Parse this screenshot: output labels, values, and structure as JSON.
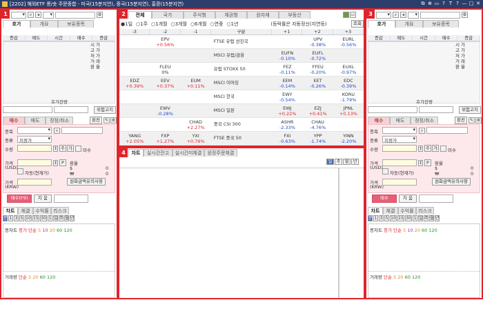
{
  "title": "[2202] 해외ETF 롱/숏 주문종합 - 미국(15분지연), 중국(15분지연), 홍콩(15분지연)",
  "window_controls": [
    "⧉",
    "⊕",
    "▭",
    "?",
    "T",
    "?",
    "—",
    "□",
    "✕"
  ],
  "badges": [
    "1",
    "2",
    "3",
    "4"
  ],
  "left": {
    "tabs": [
      "호가",
      "개요",
      "보유종목"
    ],
    "grid_headers": [
      "증감",
      "매도",
      "시간",
      "매수",
      "증감"
    ],
    "side_labels": [
      "시",
      "고",
      "저",
      "거",
      "환"
    ],
    "side_labels2": [
      "가",
      "가",
      "가",
      "래",
      "율"
    ],
    "hoga_remain": "호가잔량",
    "risk_btn": "위험고지",
    "order_tabs": [
      "매수",
      "매도",
      "정정/취소"
    ],
    "env_btn": "환전",
    "stock_lbl": "종목",
    "type_lbl": "종류",
    "type_val": "지정가",
    "qty_lbl": "수량",
    "qty_btns": [
      "주",
      "가"
    ],
    "unmarked": "미수",
    "price_usd_lbl": "가격",
    "price_usd_unit": "(USD)",
    "p_btn": "P",
    "exch_lbl": "환율",
    "usd_sym": "$",
    "krw_sym": "₩",
    "usd_val": "0",
    "krw_val": "0",
    "auto_rate": "자동(현재가)",
    "price_krw_lbl": "가격",
    "price_krw_unit": "(KRW)",
    "fx_note_btn": "원화금액유의사항",
    "submit_btn": "매수(F9)",
    "reset_btn": "지 움",
    "chart_tabs": [
      "차트",
      "체결",
      "수익률",
      "리스크"
    ],
    "periods": [
      "분",
      "1",
      "3",
      "5",
      "10",
      "15",
      "30",
      "1",
      "일",
      "주",
      "월",
      "년"
    ],
    "ma_label": "봉차트",
    "ma_tag": "종가 단순",
    "ma_vals": [
      "5",
      "10",
      "20",
      "60",
      "120"
    ],
    "vol_label": "거래량",
    "vol_tag": "단순",
    "vol_vals": [
      "5",
      "20",
      "60",
      "120"
    ]
  },
  "right": {
    "tabs": [
      "호가",
      "개요",
      "보유종목"
    ],
    "grid_headers": [
      "증감",
      "매도",
      "시간",
      "매수",
      "증감"
    ],
    "side_labels": [
      "시",
      "고",
      "저",
      "거",
      "환"
    ],
    "side_labels2": [
      "가",
      "가",
      "가",
      "래",
      "율"
    ],
    "hoga_remain": "호가잔량",
    "risk_btn": "위험고지",
    "order_tabs": [
      "매수",
      "매도",
      "정정/취소"
    ],
    "env_btn": "환전",
    "stock_lbl": "종목",
    "type_lbl": "종류",
    "type_val": "지정가",
    "qty_lbl": "수량",
    "qty_btns": [
      "주",
      "가"
    ],
    "unmarked": "미수",
    "price_usd_lbl": "가격",
    "price_usd_unit": "(USD)",
    "p_btn": "P",
    "exch_lbl": "환율",
    "usd_sym": "$",
    "krw_sym": "₩",
    "usd_val": "0",
    "krw_val": "0",
    "auto_rate": "자동(현재가)",
    "price_krw_lbl": "가격",
    "price_krw_unit": "(KRW)",
    "fx_note_btn": "원화금액유의사항",
    "submit_btn": "매수",
    "reset_btn": "지 움",
    "chart_tabs": [
      "차트",
      "체결",
      "수익률",
      "리스크"
    ],
    "periods": [
      "분",
      "1",
      "3",
      "5",
      "10",
      "15",
      "30",
      "1",
      "일",
      "주",
      "월",
      "년"
    ],
    "ma_label": "봉차트",
    "ma_tag": "종가 단순",
    "ma_vals": [
      "5",
      "10",
      "20",
      "60",
      "120"
    ],
    "vol_label": "거래량",
    "vol_tag": "단순",
    "vol_vals": [
      "5",
      "20",
      "60",
      "120"
    ]
  },
  "center": {
    "tabs": [
      "전체",
      "국가",
      "주식형",
      "채권형",
      "원자재",
      "부동산"
    ],
    "radios": [
      "1일",
      "1주",
      "1개월",
      "3개월",
      "6개월",
      "연중",
      "1년"
    ],
    "radio_selected": 0,
    "note": "(등락률은 자동정신(지연등)",
    "lookup_btn": "조회",
    "columns": [
      "-3",
      "-2",
      "-1",
      "구분",
      "+1",
      "+2",
      "+3"
    ],
    "rows": [
      {
        "name": "FTSE 유럽 선진국",
        "m3": [
          "",
          ""
        ],
        "m2": [
          "EPV",
          "+0.56%"
        ],
        "m1": [
          "",
          ""
        ],
        "p1": [
          "",
          ""
        ],
        "p2": [
          "UPV",
          "-0.38%"
        ],
        "p3": [
          "EURL",
          "-0.56%"
        ]
      },
      {
        "name": "MSCI 유럽/금융",
        "m3": [
          "",
          ""
        ],
        "m2": [
          "",
          ""
        ],
        "m1": [
          "",
          ""
        ],
        "p1": [
          "EUFN",
          "-0.10%"
        ],
        "p2": [
          "EUFL",
          "-0.72%"
        ],
        "p3": [
          "",
          ""
        ]
      },
      {
        "name": "유럽 STOXX 50",
        "m3": [
          "",
          ""
        ],
        "m2": [
          "FLEU",
          "0%"
        ],
        "m1": [
          "",
          ""
        ],
        "p1": [
          "FEZ",
          "-0.11%"
        ],
        "p2": [
          "FFEU",
          "-0.20%"
        ],
        "p3": [
          "EUXL",
          "-0.97%"
        ]
      },
      {
        "name": "MSCI 이머징",
        "m3": [
          "EDZ",
          "+0.39%"
        ],
        "m2": [
          "EEV",
          "+0.37%"
        ],
        "m1": [
          "EUM",
          "+0.11%"
        ],
        "p1": [
          "EEM",
          "-0.14%"
        ],
        "p2": [
          "EET",
          "-0.26%"
        ],
        "p3": [
          "EDC",
          "-0.39%"
        ]
      },
      {
        "name": "MSCI 한국",
        "m3": [
          "",
          ""
        ],
        "m2": [
          "",
          ""
        ],
        "m1": [
          "",
          ""
        ],
        "p1": [
          "EWY",
          "-0.54%"
        ],
        "p2": [
          "",
          ""
        ],
        "p3": [
          "KORU",
          "-1.79%"
        ]
      },
      {
        "name": "MSCI 일본",
        "m3": [
          "",
          ""
        ],
        "m2": [
          "EWV",
          "-0.28%"
        ],
        "m1": [
          "",
          ""
        ],
        "p1": [
          "EWJ",
          "+0.22%"
        ],
        "p2": [
          "EZJ",
          "+0.41%"
        ],
        "p3": [
          "JPNL",
          "+0.13%"
        ]
      },
      {
        "name": "중국 CSI 300",
        "m3": [
          "",
          ""
        ],
        "m2": [
          "",
          ""
        ],
        "m1": [
          "CHAD",
          "+2.27%"
        ],
        "p1": [
          "ASHR",
          "-2.33%"
        ],
        "p2": [
          "CHAU",
          "-4.76%"
        ],
        "p3": [
          "",
          ""
        ]
      },
      {
        "name": "FTSE 중국 50",
        "m3": [
          "YANG",
          "+2.05%"
        ],
        "m2": [
          "FXP",
          "+1.27%"
        ],
        "m1": [
          "YXI",
          "+0.76%"
        ],
        "p1": [
          "FXI",
          "-0.63%"
        ],
        "p2": [
          "YPP",
          "-1.74%"
        ],
        "p3": [
          "YINN",
          "-2.20%"
        ]
      }
    ],
    "bottom_tabs": [
      "차트",
      "실시간잔고",
      "실시간미체결",
      "원장주문체결"
    ],
    "bottom_periods": [
      "일",
      "주",
      "월",
      "년"
    ]
  }
}
